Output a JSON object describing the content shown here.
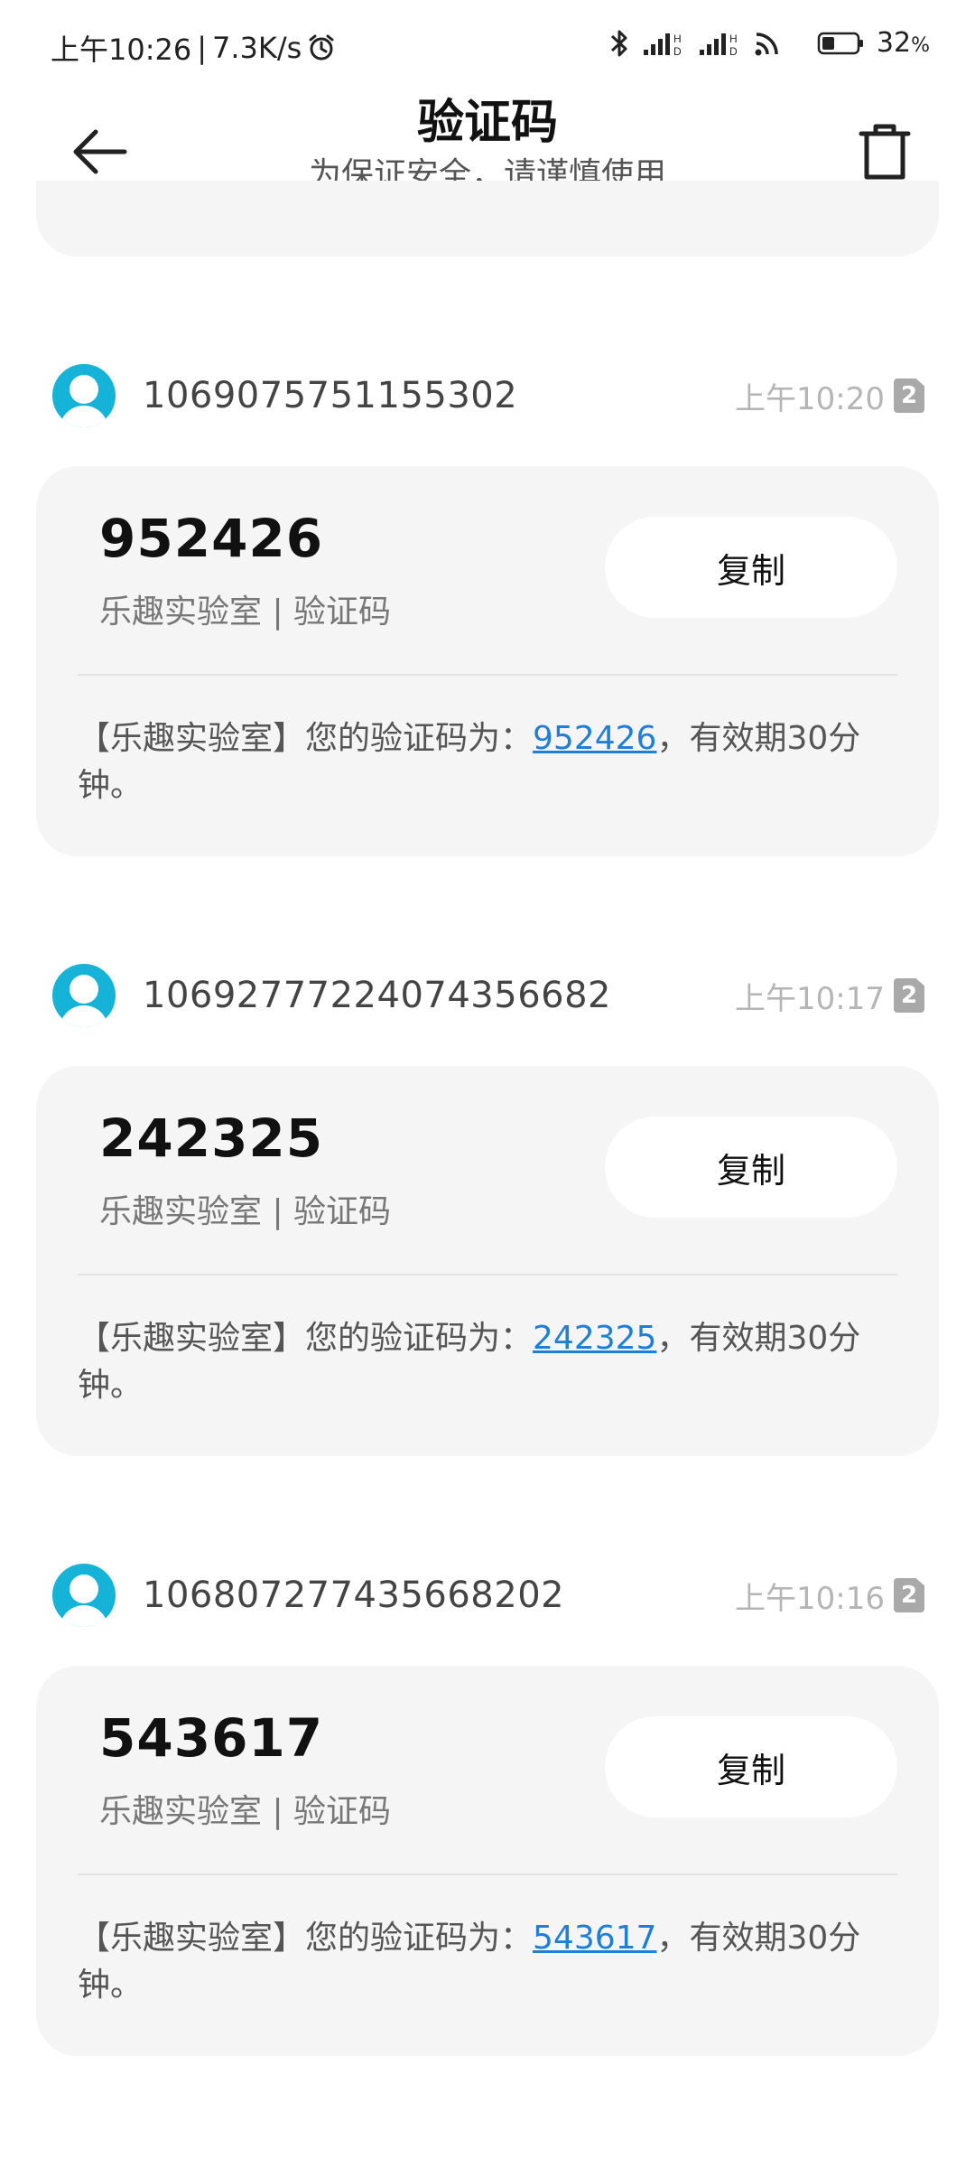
{
  "status_bar": {
    "time": "上午10:26",
    "network_speed": "7.3K/s",
    "battery_percent": "32",
    "battery_unit": "%"
  },
  "header": {
    "title": "验证码",
    "subtitle": "为保证安全，请谨慎使用"
  },
  "messages": [
    {
      "sender": "1069075751155302",
      "time": "上午10:20",
      "sim": "2",
      "code": "952426",
      "source": "乐趣实验室 | 验证码",
      "copy_label": "复制",
      "body_prefix": "【乐趣实验室】您的验证码为：",
      "body_code": "952426",
      "body_suffix": "，有效期30分钟。"
    },
    {
      "sender": "10692777224074356682",
      "time": "上午10:17",
      "sim": "2",
      "code": "242325",
      "source": "乐趣实验室 | 验证码",
      "copy_label": "复制",
      "body_prefix": "【乐趣实验室】您的验证码为：",
      "body_code": "242325",
      "body_suffix": "，有效期30分钟。"
    },
    {
      "sender": "106807277435668202",
      "time": "上午10:16",
      "sim": "2",
      "code": "543617",
      "source": "乐趣实验室 | 验证码",
      "copy_label": "复制",
      "body_prefix": "【乐趣实验室】您的验证码为：",
      "body_code": "543617",
      "body_suffix": "，有效期30分钟。"
    }
  ],
  "icons": {
    "back": "back-arrow-icon",
    "trash": "trash-icon",
    "avatar": "contact-avatar-icon",
    "alarm": "alarm-clock-icon",
    "bluetooth": "bluetooth-icon",
    "signal": "cellular-signal-icon",
    "wifi": "wifi-icon",
    "battery": "battery-icon"
  },
  "colors": {
    "avatar": "#16b3d9",
    "link": "#1f7fd8",
    "card_bg": "#f5f5f5"
  }
}
